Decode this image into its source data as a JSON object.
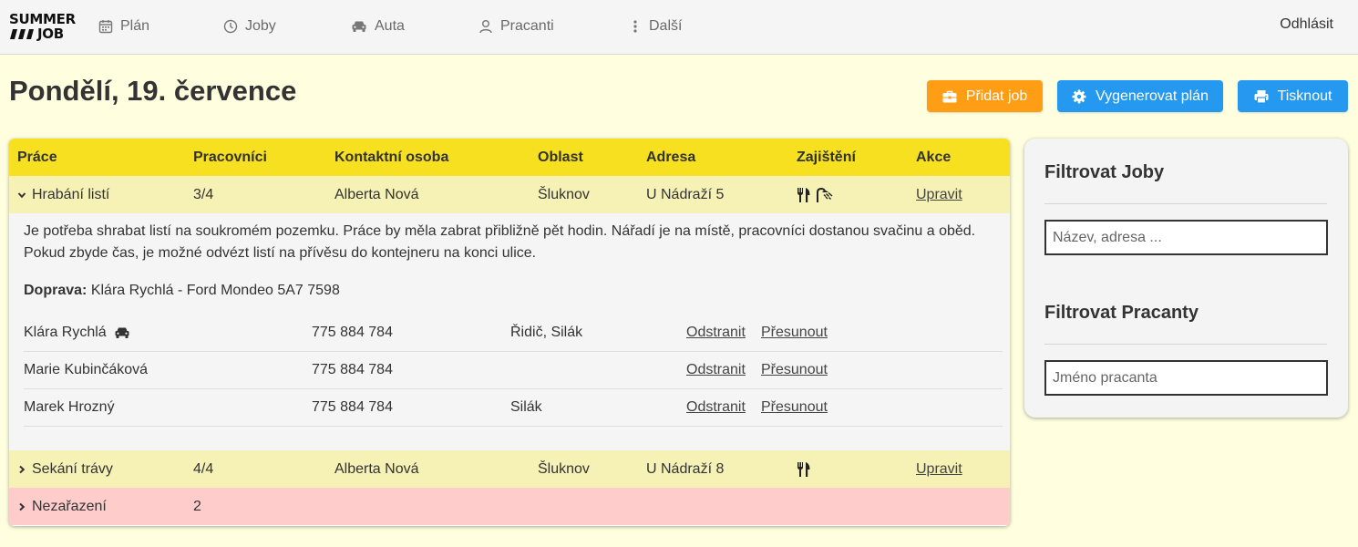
{
  "logo": {
    "line1": "SUMMER",
    "line2": "JOB"
  },
  "nav": {
    "items": [
      {
        "label": "Plán",
        "icon": "calendar-icon"
      },
      {
        "label": "Joby",
        "icon": "clock-icon"
      },
      {
        "label": "Auta",
        "icon": "car-icon"
      },
      {
        "label": "Pracanti",
        "icon": "user-icon"
      },
      {
        "label": "Další",
        "icon": "dots-vertical-icon"
      }
    ],
    "logout": "Odhlásit"
  },
  "page": {
    "title": "Pondělí, 19. července"
  },
  "actions": {
    "add_job": "Přidat job",
    "generate_plan": "Vygenerovat plán",
    "print": "Tisknout"
  },
  "table": {
    "headers": [
      "Práce",
      "Pracovníci",
      "Kontaktní osoba",
      "Oblast",
      "Adresa",
      "Zajištění",
      "Akce"
    ],
    "jobs": [
      {
        "name": "Hrabání listí",
        "workers": "3/4",
        "contact": "Alberta Nová",
        "area": "Šluknov",
        "address": "U Nádraží 5",
        "action": "Upravit",
        "amenities": [
          "utensils-icon",
          "shower-icon"
        ],
        "description": "Je potřeba shrabat listí na soukromém pozemku. Práce by měla zabrat přibližně pět hodin. Nářadí je na místě, pracovníci dostanou svačinu a oběd. Pokud zbyde čas, je možné odvézt listí na přívěsu do kontejneru na konci ulice.",
        "transport_label": "Doprava:",
        "transport_value": "Klára Rychlá - Ford Mondeo 5A7 7598",
        "assigned": [
          {
            "name": "Klára Rychlá",
            "phone": "775 884 784",
            "roles": "Řidič, Silák",
            "remove": "Odstranit",
            "move": "Přesunout"
          },
          {
            "name": "Marie Kubinčáková",
            "phone": "775 884 784",
            "roles": "",
            "remove": "Odstranit",
            "move": "Přesunout"
          },
          {
            "name": "Marek Hrozný",
            "phone": "775 884 784",
            "roles": "Silák",
            "remove": "Odstranit",
            "move": "Přesunout"
          }
        ]
      },
      {
        "name": "Sekání trávy",
        "workers": "4/4",
        "contact": "Alberta Nová",
        "area": "Šluknov",
        "address": "U Nádraží 8",
        "action": "Upravit",
        "amenities": [
          "utensils-icon"
        ]
      }
    ],
    "unassigned": {
      "name": "Nezařazení",
      "count": "2"
    }
  },
  "sidebar": {
    "jobs_title": "Filtrovat Joby",
    "jobs_placeholder": "Název, adresa ...",
    "workers_title": "Filtrovat Pracanty",
    "workers_placeholder": "Jméno pracanta"
  },
  "colors": {
    "header_yellow": "#f6e01f",
    "row_yellow": "#f6f2b6",
    "row_pink": "#ffcccc",
    "btn_orange": "#ff9d14",
    "btn_blue": "#2598ef",
    "page_bg": "#ffffe0"
  }
}
